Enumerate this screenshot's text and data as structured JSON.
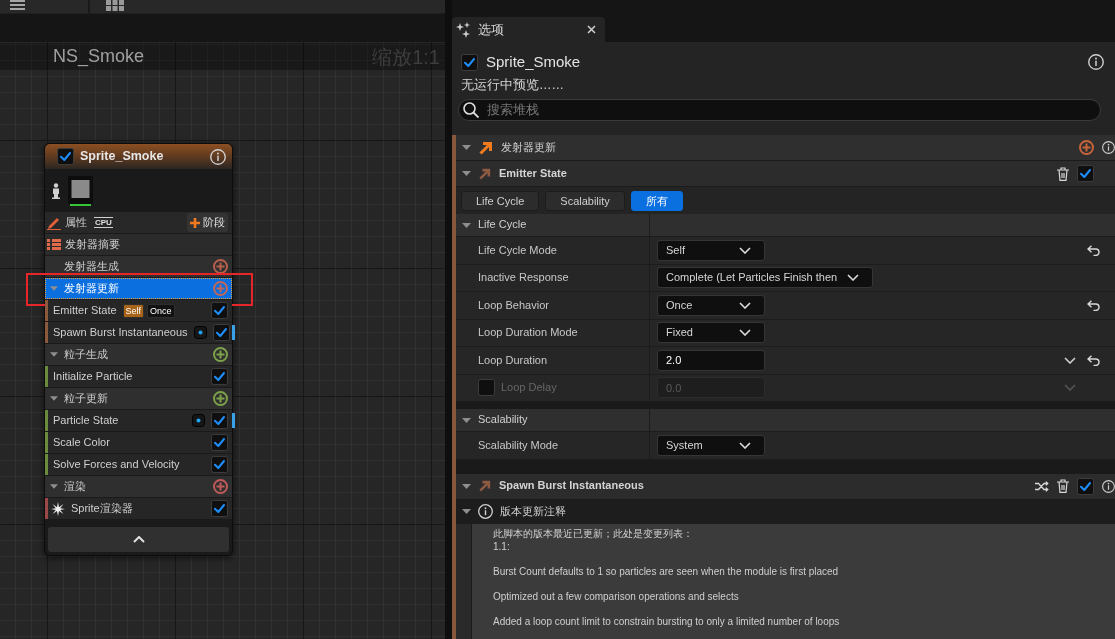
{
  "graph": {
    "title": "NS_Smoke",
    "zoom": "缩放1:1",
    "node": {
      "enabled": true,
      "title": "Sprite_Smoke",
      "properties": "属性",
      "sim_target": "CPU",
      "stage_button": "阶段",
      "items": [
        {
          "kind": "summary",
          "label": "发射器摘要",
          "selected": false,
          "boxed": false
        },
        {
          "kind": "group",
          "label": "发射器生成",
          "collapsible": false,
          "color": "#b8604c",
          "selected": false,
          "boxed": false
        },
        {
          "kind": "group",
          "label": "发射器更新",
          "collapsible": true,
          "color": "#c0665a",
          "selected": true,
          "boxed": true
        },
        {
          "kind": "module",
          "label": "Emitter State",
          "badges": [
            {
              "text": "Self",
              "color": "#a8651a"
            },
            {
              "text": "Once",
              "color": "#121212"
            }
          ],
          "indicator": false,
          "enabled": true,
          "color": "#8a5a3c",
          "selected": false,
          "boxed": false
        },
        {
          "kind": "module",
          "label": "Spawn Burst Instantaneous",
          "indicator": true,
          "enabled": true,
          "color": "#8a5a3c",
          "selected": false,
          "boxed": false
        },
        {
          "kind": "group",
          "label": "粒子生成",
          "collapsible": true,
          "color": "#7ea24a",
          "selected": false,
          "boxed": false
        },
        {
          "kind": "module",
          "label": "Initialize Particle",
          "indicator": false,
          "enabled": true,
          "color": "#6a8a3e",
          "selected": false,
          "boxed": false
        },
        {
          "kind": "group",
          "label": "粒子更新",
          "collapsible": true,
          "color": "#7ea24a",
          "selected": false,
          "boxed": false
        },
        {
          "kind": "module",
          "label": "Particle State",
          "indicator": true,
          "enabled": true,
          "color": "#6a8a3e",
          "selected": false,
          "boxed": false
        },
        {
          "kind": "module",
          "label": "Scale Color",
          "indicator": false,
          "enabled": true,
          "color": "#6a8a3e",
          "selected": false,
          "boxed": false
        },
        {
          "kind": "module",
          "label": "Solve Forces and Velocity",
          "indicator": false,
          "enabled": true,
          "color": "#6a8a3e",
          "selected": false,
          "boxed": false
        },
        {
          "kind": "group",
          "label": "渲染",
          "collapsible": true,
          "color": "#c05a5a",
          "selected": false,
          "boxed": false
        },
        {
          "kind": "renderer",
          "label": "Sprite渲染器",
          "enabled": true,
          "color": "#9a4848",
          "selected": false,
          "boxed": false
        }
      ]
    }
  },
  "details": {
    "tab": {
      "label": "选项"
    },
    "emitter": {
      "enabled": true,
      "name": "Sprite_Smoke"
    },
    "status": "无运行中预览……",
    "search": {
      "placeholder": "搜索堆栈"
    },
    "stage": {
      "label": "发射器更新",
      "expanded": true,
      "color": "#c8643c"
    },
    "modules": [
      {
        "title": "Emitter State",
        "expanded": true,
        "randomized": false,
        "enabled": true,
        "filters": [
          {
            "label": "Life Cycle",
            "selected": false
          },
          {
            "label": "Scalability",
            "selected": false
          },
          {
            "label": "所有",
            "selected": true
          }
        ],
        "sections": [
          {
            "title": "Life Cycle",
            "expanded": true,
            "properties": [
              {
                "kind": "dropdown",
                "label": "Life Cycle Mode",
                "value": "Self",
                "resettable": true
              },
              {
                "kind": "dropdown",
                "label": "Inactive Response",
                "value": "Complete (Let Particles Finish then",
                "resettable": false
              },
              {
                "kind": "dropdown",
                "label": "Loop Behavior",
                "value": "Once",
                "resettable": true
              },
              {
                "kind": "dropdown",
                "label": "Loop Duration Mode",
                "value": "Fixed",
                "resettable": false
              },
              {
                "kind": "number",
                "label": "Loop Duration",
                "value": "2.0",
                "resettable": true
              },
              {
                "kind": "number",
                "label": "Loop Delay",
                "value": "0.0",
                "resettable": false,
                "condition": {
                  "checked": false
                }
              }
            ]
          },
          {
            "title": "Scalability",
            "expanded": true,
            "properties": [
              {
                "kind": "dropdown",
                "label": "Scalability Mode",
                "value": "System",
                "resettable": false
              }
            ]
          }
        ]
      },
      {
        "title": "Spawn Burst Instantaneous",
        "expanded": true,
        "randomized": true,
        "enabled": true,
        "notes": {
          "title": "版本更新注释",
          "expanded": true,
          "paragraphs": [
            "此脚本的版本最近已更新；此处是变更列表：\n1.1:",
            "Burst Count defaults to 1 so particles are seen when the module is first placed",
            "Optimized out a few comparison operations and selects",
            "Added a loop count limit to constrain bursting to only a limited number of loops"
          ]
        }
      }
    ]
  }
}
